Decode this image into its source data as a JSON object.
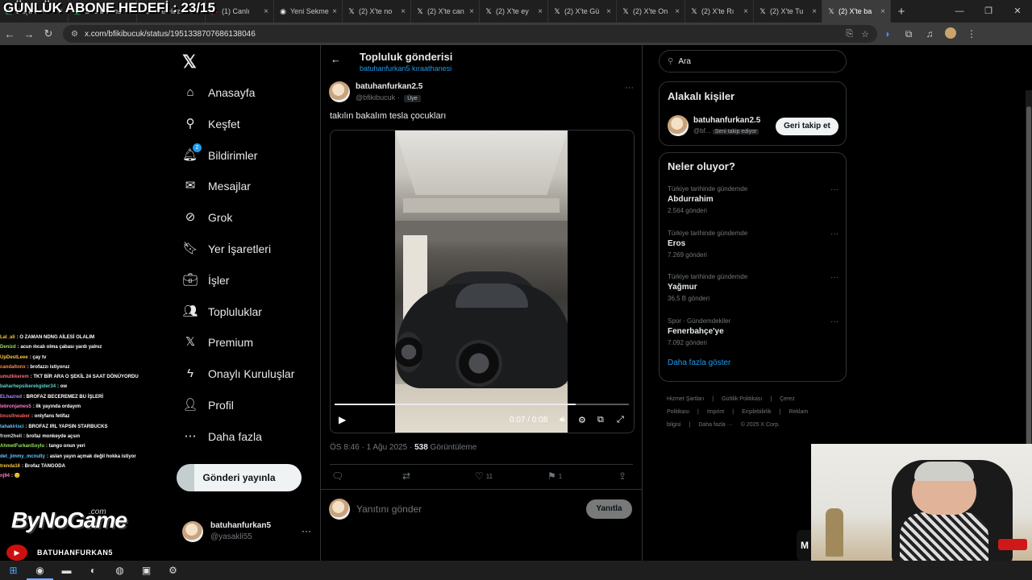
{
  "overlay": {
    "goal_text": "GÜNLÜK ABONE HEDEFİ : 23/15"
  },
  "browser": {
    "tabs": [
      {
        "title": "Başlatıcı",
        "icon": "app-icon",
        "active": false
      },
      {
        "title": "Streamlabs",
        "icon": "app-icon",
        "active": false
      },
      {
        "title": "X'te Haz",
        "icon": "x-icon",
        "active": false
      },
      {
        "title": "(1) Canlı",
        "icon": "youtube-icon",
        "active": false
      },
      {
        "title": "Yeni Sekme",
        "icon": "chrome-icon",
        "active": false
      },
      {
        "title": "(2) X'te no",
        "icon": "x-icon",
        "active": false
      },
      {
        "title": "(2) X'te can",
        "icon": "x-icon",
        "active": false
      },
      {
        "title": "(2) X'te ey",
        "icon": "x-icon",
        "active": false
      },
      {
        "title": "(2) X'te Gü",
        "icon": "x-icon",
        "active": false
      },
      {
        "title": "(2) X'te On",
        "icon": "x-icon",
        "active": false
      },
      {
        "title": "(2) X'te Rı",
        "icon": "x-icon",
        "active": false
      },
      {
        "title": "(2) X'te Tu",
        "icon": "x-icon",
        "active": false
      },
      {
        "title": "(2) X'te ba",
        "icon": "x-icon",
        "active": true
      }
    ],
    "url": "x.com/bfikibucuk/status/1951338707686138046"
  },
  "sidebar": {
    "logo": "𝕏",
    "items": [
      {
        "label": "Anasayfa",
        "icon": "home-icon",
        "glyph": "⌂"
      },
      {
        "label": "Keşfet",
        "icon": "search-icon",
        "glyph": "⚲"
      },
      {
        "label": "Bildirimler",
        "icon": "bell-icon",
        "glyph": "🔔︎",
        "badge": "2"
      },
      {
        "label": "Mesajlar",
        "icon": "mail-icon",
        "glyph": "✉"
      },
      {
        "label": "Grok",
        "icon": "grok-icon",
        "glyph": "⊘"
      },
      {
        "label": "Yer İşaretleri",
        "icon": "bookmark-icon",
        "glyph": "🔖︎"
      },
      {
        "label": "İşler",
        "icon": "briefcase-icon",
        "glyph": "💼︎"
      },
      {
        "label": "Topluluklar",
        "icon": "people-icon",
        "glyph": "👥︎"
      },
      {
        "label": "Premium",
        "icon": "x-premium-icon",
        "glyph": "𝕏"
      },
      {
        "label": "Onaylı Kuruluşlar",
        "icon": "lightning-icon",
        "glyph": "ϟ"
      },
      {
        "label": "Profil",
        "icon": "person-icon",
        "glyph": "👤︎"
      },
      {
        "label": "Daha fazla",
        "icon": "more-circle-icon",
        "glyph": "⋯"
      }
    ],
    "post_button": "Gönderi yayınla",
    "account": {
      "name": "batuhanfurkan5",
      "handle": "@yasakli55"
    }
  },
  "main": {
    "header_title": "Topluluk gönderisi",
    "header_sub": "batuhanfurkan5 kıraathanesi",
    "post": {
      "author": "batuhanfurkan2.5",
      "handle": "@bfikibucuk",
      "dot": "·",
      "member": "Üye",
      "text": "takılın bakalım tesla çocukları",
      "video_time": "0:07 / 0:08",
      "progress": 0.82,
      "timestamp": "ÖS 8:46 · 1 Ağu 2025 · ",
      "views": "538",
      "views_label": " Görüntüleme",
      "likes": "11",
      "bookmarks": "1"
    },
    "reply_placeholder": "Yanıtını gönder",
    "reply_button": "Yanıtla"
  },
  "right": {
    "search_placeholder": "Ara",
    "relevant_title": "Alakalı kişiler",
    "relevant_person": {
      "name": "batuhanfurkan2.5",
      "handle": "@bf...",
      "follows_you": "Seni takip ediyor",
      "button": "Geri takip et"
    },
    "trends_title": "Neler oluyor?",
    "trends": [
      {
        "context": "Türkiye tarihinde gündemde",
        "name": "Abdurrahim",
        "count": "2.564 gönderi"
      },
      {
        "context": "Türkiye tarihinde gündemde",
        "name": "Eros",
        "count": "7.269 gönderi"
      },
      {
        "context": "Türkiye tarihinde gündemde",
        "name": "Yağmur",
        "count": "36,5 B gönderi"
      },
      {
        "context": "Spor · Gündemdekiler",
        "name": "Fenerbahçe'ye",
        "count": "7.092 gönderi"
      }
    ],
    "show_more": "Daha fazla göster",
    "footer": [
      "Hizmet Şartları",
      "|",
      "Gizlilik Politikası",
      "|",
      "Çerez Politikası",
      "|",
      "Imprint",
      "|",
      "Erişilebilirlik",
      "|",
      "Reklam bilgisi",
      "|",
      "Daha fazla ···",
      "© 2025 X Corp."
    ]
  },
  "chat": [
    {
      "user": "Lal_ali",
      "color": "#f5c542",
      "msg": ": O ZAMAN NDNG AİLESİ OLALIM"
    },
    {
      "user": "Denizd",
      "color": "#9be15d",
      "msg": ": acun ılıcalı olma çabası yardı yalnız"
    },
    {
      "user": "UpDestLeee",
      "color": "#f5c542",
      "msg": ": çay tv"
    },
    {
      "user": "candaltonx",
      "color": "#ff8c42",
      "msg": ": brofazzı istiyoruz"
    },
    {
      "user": "umutkkerem",
      "color": "#ff6b6b",
      "msg": ": TKT BİR ARA O ŞEKİL 24 SAAT DÖNÜYORDU"
    },
    {
      "user": "baharhepsikerekgider34",
      "color": "#5fd3c4",
      "msg": ": ow"
    },
    {
      "user": "ELhazred",
      "color": "#a58cff",
      "msg": ": BROFAZ BECEREMEZ BU İŞLERİ"
    },
    {
      "user": "lebronjames5",
      "color": "#ff7ac6",
      "msg": ": ilk yayında ordayım"
    },
    {
      "user": "bxusllneaber",
      "color": "#ff5e5e",
      "msg": ": onlyfans fetifaz"
    },
    {
      "user": "tahakirisci",
      "color": "#66c2ff",
      "msg": ": BROFAZ IRL YAPSIN STARBUCKS"
    },
    {
      "user": "from2heli",
      "color": "#dddddd",
      "msg": ": brofaz monkeyde açsın"
    },
    {
      "user": "AhmetFurkanSoylu",
      "color": "#9be15d",
      "msg": ": tango onun yeri"
    },
    {
      "user": "det_jimmy_mcnulty",
      "color": "#66c2ff",
      "msg": ": aslan yayın açmak değil hokka istiyor"
    },
    {
      "user": "trenda16",
      "color": "#f5c542",
      "msg": ": Brofaz TANGODA"
    },
    {
      "user": "nj94",
      "color": "#ff7ac6",
      "msg": ": 😊"
    }
  ],
  "stream": {
    "brand": "ByNoGame",
    "brand_suffix": ".com",
    "streamer": "BATUHANFURKAN5",
    "side_letter": "M"
  }
}
